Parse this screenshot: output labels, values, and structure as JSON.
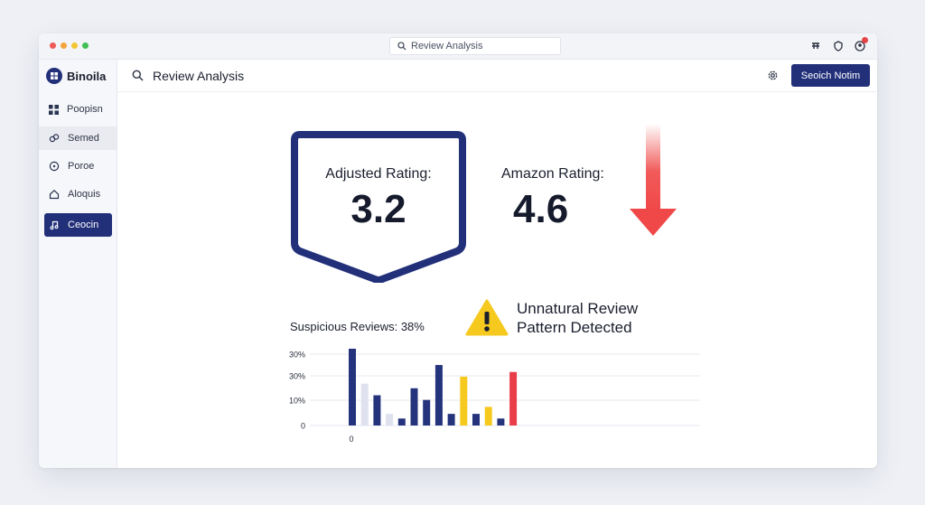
{
  "browser": {
    "url_text": "Review Analysis"
  },
  "sidebar": {
    "brand": "Binoila",
    "items": [
      {
        "label": "Poopisn",
        "icon": "grid-icon"
      },
      {
        "label": "Semed",
        "icon": "link-icon"
      },
      {
        "label": "Poroe",
        "icon": "circle-icon"
      },
      {
        "label": "Aloquis",
        "icon": "home-icon"
      },
      {
        "label": "Ceocin",
        "icon": "music-note-icon"
      }
    ],
    "active_index": 4
  },
  "topbar": {
    "search_text": "Review Analysis",
    "button_label": "Seoich Notim"
  },
  "ratings": {
    "adjusted_title": "Adjusted Rating:",
    "adjusted_value": "3.2",
    "amazon_title": "Amazon Rating:",
    "amazon_value": "4.6"
  },
  "alerts": {
    "suspicious_label": "Suspicious Reviews: 38%",
    "warning_line1": "Unnatural Review",
    "warning_line2": "Pattern Detected"
  },
  "colors": {
    "accent": "#22307a",
    "down_arrow": "#f04848",
    "warning": "#f6c91f",
    "bar_navy": "#25337d",
    "bar_light": "#dfe1ef",
    "bar_yellow": "#f6c91f",
    "bar_red": "#ea3d4a"
  },
  "chart_data": {
    "type": "bar",
    "yticks": [
      "30%",
      "30%",
      "10%",
      "0"
    ],
    "xticks": [
      "0"
    ],
    "values": [
      33,
      18,
      13,
      5,
      3,
      16,
      11,
      26,
      5,
      21,
      5,
      8,
      3,
      23
    ],
    "bar_colors": [
      "navy",
      "light",
      "navy",
      "light",
      "navy",
      "navy",
      "navy",
      "navy",
      "navy",
      "yellow",
      "navy",
      "yellow",
      "navy",
      "red"
    ],
    "ylim": [
      0,
      33
    ],
    "grid": true
  }
}
